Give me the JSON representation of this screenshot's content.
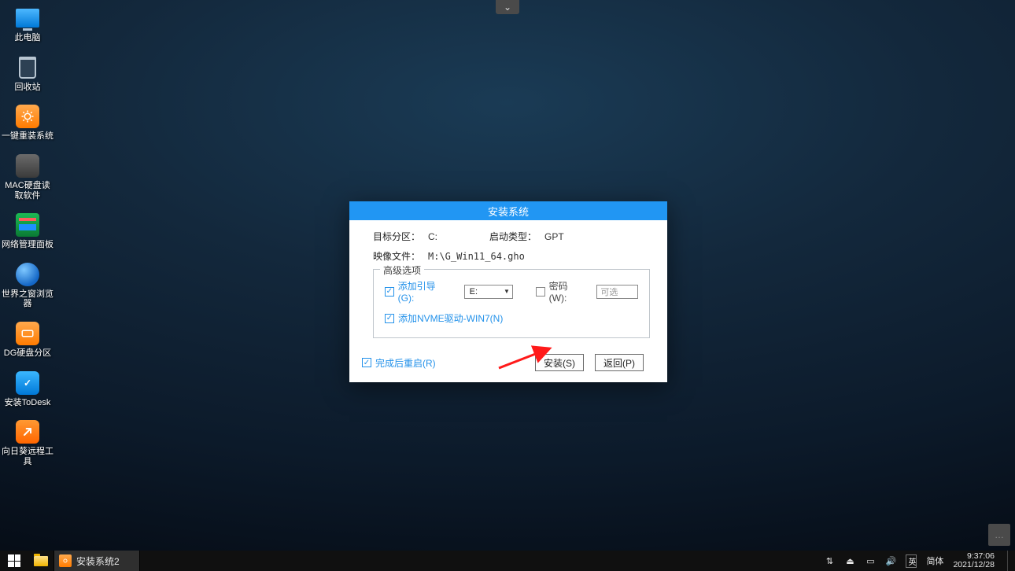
{
  "topTab": {
    "glyph": "⌄"
  },
  "desktop": {
    "items": [
      {
        "name": "this-pc",
        "label": "此电脑"
      },
      {
        "name": "recycle-bin",
        "label": "回收站"
      },
      {
        "name": "one-click-install",
        "label": "一键重装系统"
      },
      {
        "name": "mac-disk-reader",
        "label": "MAC硬盘读\n取软件"
      },
      {
        "name": "net-admin-panel",
        "label": "网络管理面板"
      },
      {
        "name": "world-browser",
        "label": "世界之窗浏览\n器"
      },
      {
        "name": "dg-partition",
        "label": "DG硬盘分区"
      },
      {
        "name": "install-todesk",
        "label": "安装ToDesk"
      },
      {
        "name": "sunlogin-tool",
        "label": "向日葵远程工\n具"
      }
    ]
  },
  "dialog": {
    "title": "安装系统",
    "targetPartitionLabel": "目标分区：",
    "targetPartitionValue": "C:",
    "bootTypeLabel": "启动类型：",
    "bootTypeValue": "GPT",
    "imageFileLabel": "映像文件：",
    "imageFileValue": "M:\\G_Win11_64.gho",
    "advancedLegend": "高级选项",
    "addBootLabel": "添加引导(G):",
    "addBootSelected": "E:",
    "passwordLabel": "密码(W):",
    "passwordPlaceholder": "可选",
    "addNvmeLabel": "添加NVME驱动-WIN7(N)",
    "restartLabel": "完成后重启(R)",
    "installBtn": "安装(S)",
    "backBtn": "返回(P)",
    "check_addBoot": true,
    "check_password": false,
    "check_nvme": true,
    "check_restart": true
  },
  "brSquare": {
    "glyph": "…"
  },
  "taskbar": {
    "activeApp": "安装系统2",
    "tray": {
      "wifiGlyph": "⇅",
      "usbGlyph": "⏏",
      "batteryGlyph": "▭",
      "volumeGlyph": "🔊",
      "imeLang": "英",
      "imeMode": "简体",
      "time": "9:37:06",
      "date": "2021/12/28"
    }
  }
}
